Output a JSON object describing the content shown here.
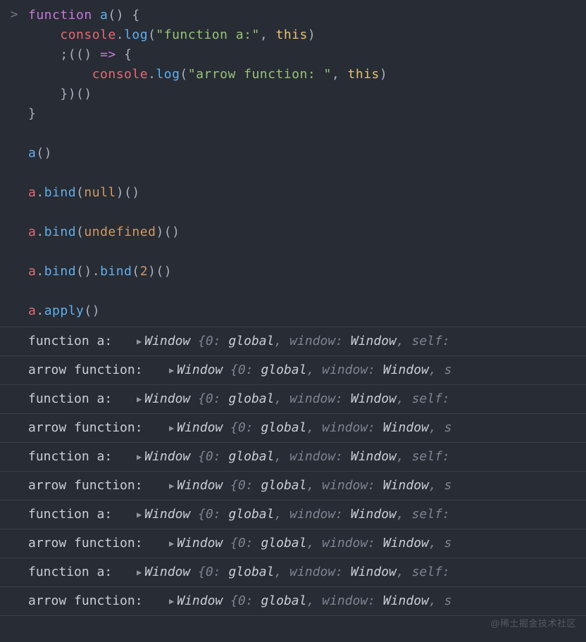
{
  "prompt": ">",
  "code": {
    "line1": {
      "kw": "function",
      "fn": "a",
      "p1": "()",
      "p2": " {"
    },
    "line2": {
      "indent": "    ",
      "obj": "console",
      "dot": ".",
      "m": "log",
      "open": "(",
      "s": "\"function a:\"",
      "comma": ", ",
      "this": "this",
      "close": ")"
    },
    "line3": {
      "indent": "    ",
      "p1": ";((",
      "p2": ") ",
      "arrow": "=>",
      "p3": " {"
    },
    "line4": {
      "indent": "        ",
      "obj": "console",
      "dot": ".",
      "m": "log",
      "open": "(",
      "s": "\"arrow function: \"",
      "comma": ", ",
      "this": "this",
      "close": ")"
    },
    "line5": {
      "indent": "    ",
      "p": "})()"
    },
    "line6": {
      "p": "}"
    },
    "blank_a": "",
    "line7": {
      "id": "a",
      "p": "()"
    },
    "blank_b": "",
    "line8": {
      "id": "a",
      "dot": ".",
      "m": "bind",
      "open": "(",
      "arg": "null",
      "close": ")()"
    },
    "blank_c": "",
    "line9": {
      "id": "a",
      "dot": ".",
      "m": "bind",
      "open": "(",
      "arg": "undefined",
      "close": ")()"
    },
    "blank_d": "",
    "line10": {
      "id": "a",
      "dot1": ".",
      "m1": "bind",
      "p1": "().",
      "m2": "bind",
      "p2": "(",
      "arg": "2",
      "p3": ")()"
    },
    "blank_e": "",
    "line11": {
      "id": "a",
      "dot": ".",
      "m": "apply",
      "p": "()"
    }
  },
  "output": {
    "labels": {
      "func": "function a: ",
      "arrow": "arrow function:  "
    },
    "obj": {
      "name": "Window ",
      "body": "{0: global, window: Window, self:",
      "body_trim": "{0: global, window: Window, s"
    },
    "lines": [
      {
        "kind": "func",
        "trim": false
      },
      {
        "kind": "arrow",
        "trim": true
      },
      {
        "kind": "func",
        "trim": false
      },
      {
        "kind": "arrow",
        "trim": true
      },
      {
        "kind": "func",
        "trim": false
      },
      {
        "kind": "arrow",
        "trim": true
      },
      {
        "kind": "func",
        "trim": false
      },
      {
        "kind": "arrow",
        "trim": true
      },
      {
        "kind": "func",
        "trim": false
      },
      {
        "kind": "arrow",
        "trim": true
      }
    ]
  },
  "watermark": "@稀土掘金技术社区"
}
